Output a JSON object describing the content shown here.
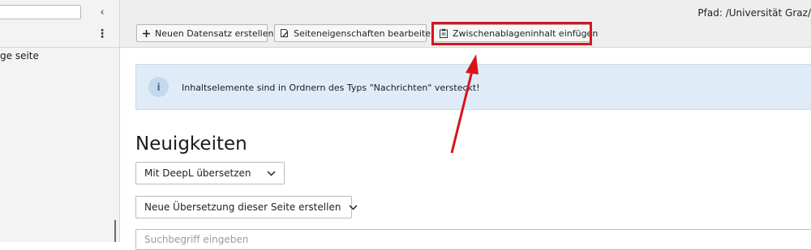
{
  "tree": {
    "search_value": "",
    "collapse_glyph": "‹",
    "more_glyph": "⋮",
    "node_label": "ge seite"
  },
  "header": {
    "path": "Pfad: /Universität Graz/",
    "buttons": {
      "new_record": "Neuen Datensatz erstellen",
      "page_properties": "Seiteneigenschaften bearbeiten",
      "paste_clipboard": "Zwischenablageninhalt einfügen"
    }
  },
  "info": {
    "icon_glyph": "i",
    "message": "Inhaltselemente sind in Ordnern des Typs \"Nachrichten\" versteckt!"
  },
  "main": {
    "title": "Neuigkeiten",
    "deepl_select": "Mit DeepL übersetzen",
    "translation_select": "Neue Übersetzung dieser Seite erstellen",
    "search_placeholder": "Suchbegriff eingeben"
  },
  "annotation": {
    "highlight_color": "#d8141b",
    "arrow_color": "#d8141b"
  }
}
